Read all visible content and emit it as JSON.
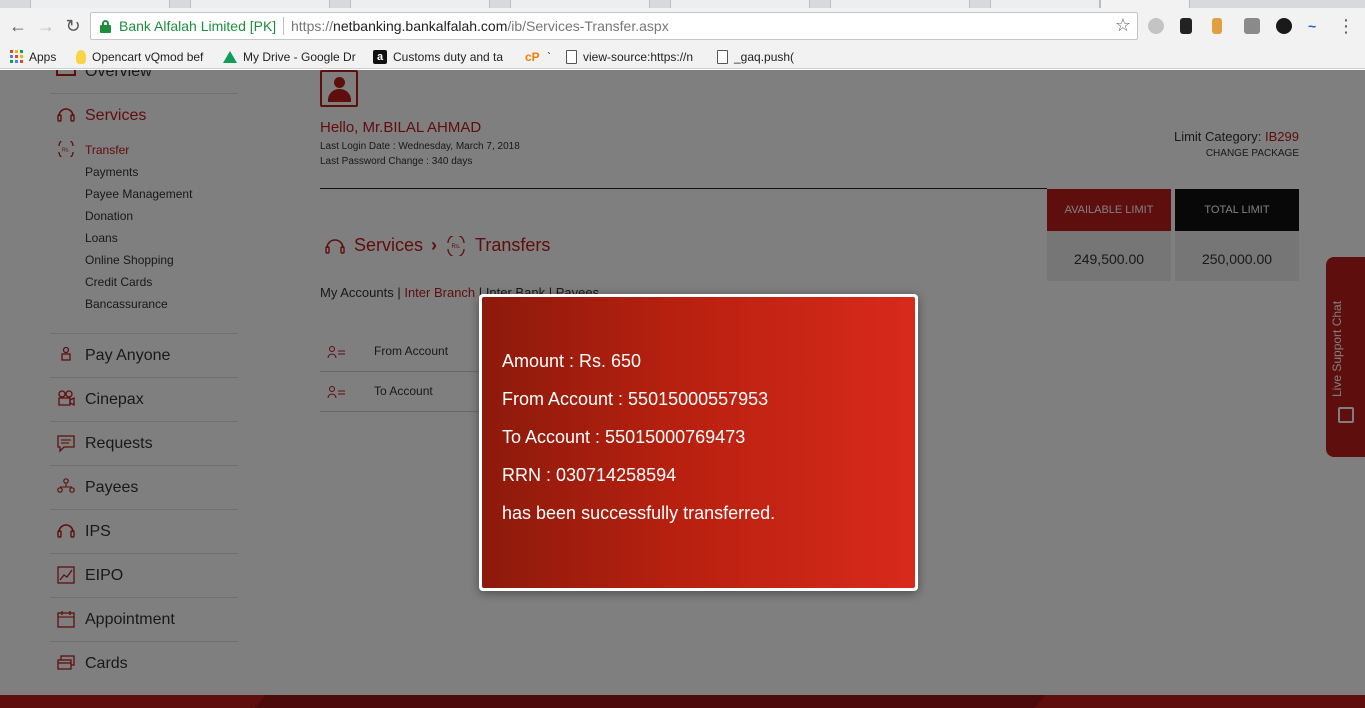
{
  "browser": {
    "site_name": "Bank Alfalah Limited [PK]",
    "url_scheme": "https://",
    "url_host": "netbanking.bankalfalah.com",
    "url_path": "/ib/Services-Transfer.aspx"
  },
  "bookmarks": [
    {
      "label": "Apps",
      "icon": "apps-grid-icon"
    },
    {
      "label": "Opencart vQmod bef",
      "icon": "lightbulb-icon"
    },
    {
      "label": "My Drive - Google Dr",
      "icon": "google-drive-icon"
    },
    {
      "label": "Customs duty and ta",
      "icon": "amazon-icon"
    },
    {
      "label": "`",
      "icon": "link-icon"
    },
    {
      "label": "view-source:https://n",
      "icon": "page-icon"
    },
    {
      "label": "_gaq.push(",
      "icon": "page-icon"
    }
  ],
  "sidebar": {
    "top_item": "Overview",
    "services": "Services",
    "sub_items": [
      "Transfer",
      "Payments",
      "Payee Management",
      "Donation",
      "Loans",
      "Online Shopping",
      "Credit Cards",
      "Bancassurance"
    ],
    "items": [
      "Pay Anyone",
      "Cinepax",
      "Requests",
      "Payees",
      "IPS",
      "EIPO",
      "Appointment",
      "Cards"
    ]
  },
  "user": {
    "greeting": "Hello, Mr.BILAL AHMAD",
    "last_login": "Last Login Date : Wednesday, March 7, 2018",
    "last_password": "Last Password Change : 340 days"
  },
  "limits": {
    "category_label": "Limit Category:",
    "category_value": "IB299",
    "change_package": "CHANGE PACKAGE",
    "available_label": "AVAILABLE LIMIT",
    "available_value": "249,500.00",
    "total_label": "TOTAL LIMIT",
    "total_value": "250,000.00"
  },
  "breadcrumb": {
    "services": "Services",
    "transfers": "Transfers"
  },
  "sub_tabs": {
    "my_accounts": "My Accounts",
    "inter_branch": "Inter Branch",
    "inter_bank": "Inter Bank",
    "payees": "Payees",
    "sep": "|"
  },
  "form": {
    "from_account": "From Account",
    "to_account": "To Account"
  },
  "chat": {
    "label": "Live Support Chat"
  },
  "dialog": {
    "amount": "Amount : Rs. 650",
    "from": "From Account : 55015000557953",
    "to": "To Account : 55015000769473",
    "rrn": "RRN : 030714258594",
    "message": "has been successfully transferred."
  },
  "colors": {
    "brand_red": "#bf1c1c",
    "secure_green": "#1e8e3e"
  }
}
